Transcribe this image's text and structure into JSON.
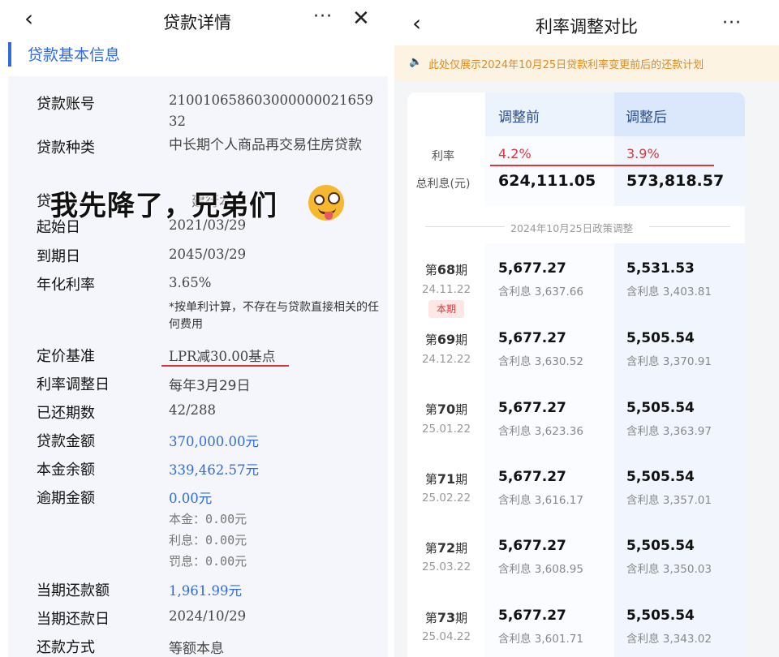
{
  "left": {
    "nav": {
      "back_icon": "‹",
      "title": "贷款详情",
      "more_icon": "···",
      "close_icon": "✕"
    },
    "section_title": "贷款基本信息",
    "rows": [
      {
        "label": "贷款账号",
        "value": "210010658603000000021659 32"
      },
      {
        "label": "贷款种类",
        "value": "中长期个人商品再交易住房贷款"
      },
      {
        "label": "贷",
        "value": "建行本"
      },
      {
        "label": "起始日",
        "value": "2021/03/29"
      },
      {
        "label": "到期日",
        "value": "2045/03/29"
      },
      {
        "label": "年化利率",
        "value": "3.65%"
      },
      {
        "label": "定价基准",
        "value": "LPR减30.00基点"
      },
      {
        "label": "利率调整日",
        "value": "每年3月29日"
      },
      {
        "label": "已还期数",
        "value": "42/288"
      },
      {
        "label": "贷款金额",
        "value": "370,000.00元"
      },
      {
        "label": "本金余额",
        "value": "339,462.57元"
      },
      {
        "label": "逾期金额",
        "value": "0.00元"
      },
      {
        "label": "当期还款额",
        "value": "1,961.99元"
      },
      {
        "label": "当期还款日",
        "value": "2024/10/29"
      },
      {
        "label": "还款方式",
        "value": "等额本息"
      }
    ],
    "rate_note": "*按单利计算，不存在与贷款直接相关的任何费用",
    "overdue_sub": [
      "本金：0.00元",
      "利息：0.00元",
      "罚息：0.00元"
    ],
    "overlay_text": "我先降了，兄弟们",
    "emoji_icon": "zany-face-emoji"
  },
  "right": {
    "nav": {
      "back_icon": "‹",
      "title": "利率调整对比",
      "more_icon": "···"
    },
    "notice": "此处仅展示2024年10月25日贷款利率变更前后的还款计划",
    "notice_icon": "speaker-icon",
    "headers": {
      "before": "调整前",
      "after": "调整后"
    },
    "rate_label": "利率",
    "rate_before": "4.2%",
    "rate_after": "3.9%",
    "total_label": "总利息(元)",
    "total_before": "624,111.05",
    "total_after": "573,818.57",
    "policy_label": "2024年10月25日政策调整",
    "current_tag": "本期",
    "periods": [
      {
        "prefix": "第",
        "num": "68",
        "suffix": "期",
        "date": "24.11.22",
        "before_amt": "5,677.27",
        "before_int": "含利息 3,637.66",
        "after_amt": "5,531.53",
        "after_int": "含利息 3,403.81"
      },
      {
        "prefix": "第",
        "num": "69",
        "suffix": "期",
        "date": "24.12.22",
        "before_amt": "5,677.27",
        "before_int": "含利息 3,630.52",
        "after_amt": "5,505.54",
        "after_int": "含利息 3,370.91"
      },
      {
        "prefix": "第",
        "num": "70",
        "suffix": "期",
        "date": "25.01.22",
        "before_amt": "5,677.27",
        "before_int": "含利息 3,623.36",
        "after_amt": "5,505.54",
        "after_int": "含利息 3,363.97"
      },
      {
        "prefix": "第",
        "num": "71",
        "suffix": "期",
        "date": "25.02.22",
        "before_amt": "5,677.27",
        "before_int": "含利息 3,616.17",
        "after_amt": "5,505.54",
        "after_int": "含利息 3,357.01"
      },
      {
        "prefix": "第",
        "num": "72",
        "suffix": "期",
        "date": "25.03.22",
        "before_amt": "5,677.27",
        "before_int": "含利息 3,608.95",
        "after_amt": "5,505.54",
        "after_int": "含利息 3,350.03"
      },
      {
        "prefix": "第",
        "num": "73",
        "suffix": "期",
        "date": "25.04.22",
        "before_amt": "5,677.27",
        "before_int": "含利息 3,601.71",
        "after_amt": "5,505.54",
        "after_int": "含利息 3,343.02"
      }
    ]
  }
}
